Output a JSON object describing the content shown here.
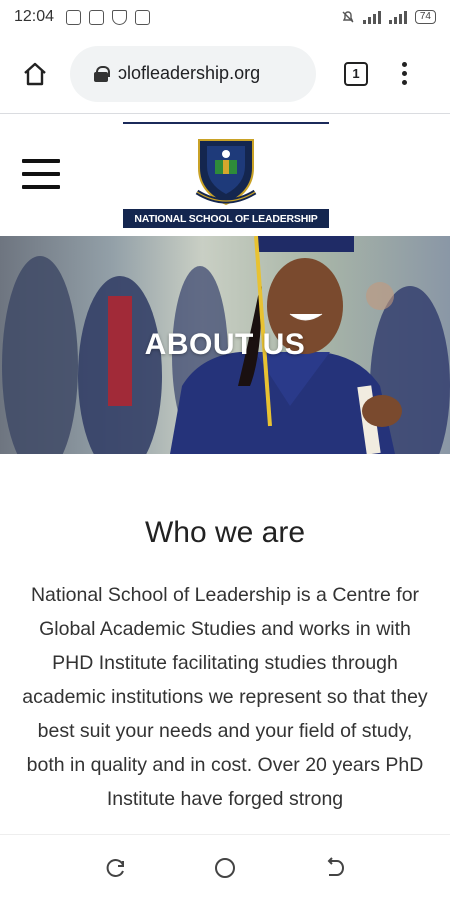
{
  "status_bar": {
    "time": "12:04",
    "left_icons": [
      "image-icon",
      "clipboard-icon",
      "shield-icon",
      "device-icon"
    ],
    "right_icons": [
      "mute-icon",
      "signal-icon",
      "signal-icon"
    ],
    "battery": "74"
  },
  "browser": {
    "url": "ɔlofleadership.org",
    "tab_count": "1"
  },
  "site": {
    "logo_text": "NATIONAL SCHOOL OF LEADERSHIP"
  },
  "hero": {
    "title": "ABOUT US"
  },
  "section": {
    "title": "Who we are",
    "body": "National School of Leadership is a Centre for Global Academic Studies and works in with PHD Institute facilitating studies through academic institutions we represent so that they best suit your needs and your field of study, both in quality and in cost. Over 20 years PhD Institute have forged strong"
  },
  "nav": {
    "buttons": [
      "recent-apps-icon",
      "home-circle-icon",
      "back-icon"
    ]
  },
  "colors": {
    "brand_navy": "#14264f",
    "url_pill": "#f1f3f4"
  }
}
